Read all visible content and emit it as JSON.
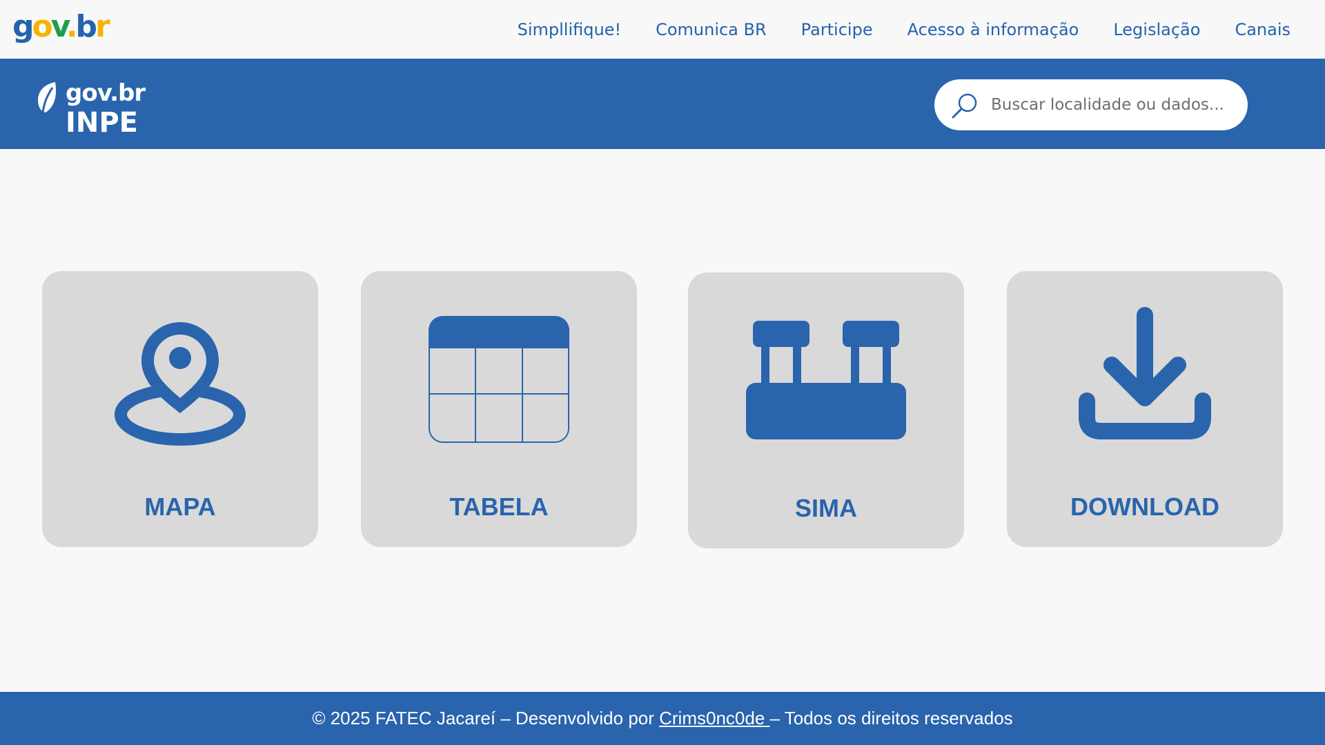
{
  "topbar": {
    "logo_parts": [
      "g",
      "o",
      "v",
      ".",
      "b",
      "r"
    ],
    "nav": [
      {
        "label": "Simpllifique!"
      },
      {
        "label": "Comunica BR"
      },
      {
        "label": "Participe"
      },
      {
        "label": "Acesso à informação"
      },
      {
        "label": "Legislação"
      },
      {
        "label": "Canais"
      }
    ]
  },
  "header": {
    "logo_gov": "gov.br",
    "logo_inpe": "INPE",
    "search": {
      "placeholder": "Buscar localidade ou dados...",
      "value": "",
      "icon": "search-icon"
    }
  },
  "cards": [
    {
      "label": "MAPA",
      "icon": "map-pin-icon"
    },
    {
      "label": "TABELA",
      "icon": "table-icon"
    },
    {
      "label": "SIMA",
      "icon": "sima-station-icon"
    },
    {
      "label": "DOWNLOAD",
      "icon": "download-icon"
    }
  ],
  "footer": {
    "prefix": "© 2025 FATEC Jacareí – Desenvolvido por ",
    "link": "Crims0nc0de ",
    "suffix": "– Todos os direitos reservados"
  },
  "colors": {
    "primary": "#2964ad",
    "card_bg": "#d9d9d9",
    "page_bg": "#f8f8f8"
  }
}
